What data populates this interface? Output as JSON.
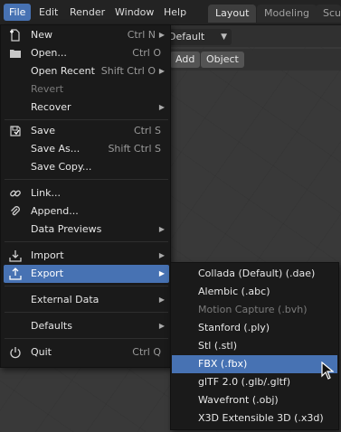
{
  "topbar": {
    "menus": [
      "File",
      "Edit",
      "Render",
      "Window",
      "Help"
    ],
    "workspaces": [
      "Layout",
      "Modeling",
      "Scu"
    ]
  },
  "viewport": {
    "orientation_value": "Default",
    "buttons": [
      "Add",
      "Object"
    ]
  },
  "file_menu": {
    "items": [
      {
        "label": "New",
        "shortcut": "Ctrl N",
        "icon": "new-file-icon",
        "submenu": true
      },
      {
        "label": "Open...",
        "shortcut": "Ctrl O",
        "icon": "folder-icon",
        "submenu": false
      },
      {
        "label": "Open Recent",
        "shortcut": "Shift Ctrl O",
        "icon": "",
        "submenu": true
      },
      {
        "label": "Revert",
        "shortcut": "",
        "icon": "",
        "submenu": false,
        "disabled": true
      },
      {
        "label": "Recover",
        "shortcut": "",
        "icon": "",
        "submenu": true
      },
      {
        "label": "Save",
        "shortcut": "Ctrl S",
        "icon": "save-icon",
        "submenu": false
      },
      {
        "label": "Save As...",
        "shortcut": "Shift Ctrl S",
        "icon": "",
        "submenu": false
      },
      {
        "label": "Save Copy...",
        "shortcut": "",
        "icon": "",
        "submenu": false
      },
      {
        "label": "Link...",
        "shortcut": "",
        "icon": "link-icon",
        "submenu": false
      },
      {
        "label": "Append...",
        "shortcut": "",
        "icon": "paperclip-icon",
        "submenu": false
      },
      {
        "label": "Data Previews",
        "shortcut": "",
        "icon": "",
        "submenu": true
      },
      {
        "label": "Import",
        "shortcut": "",
        "icon": "import-icon",
        "submenu": true
      },
      {
        "label": "Export",
        "shortcut": "",
        "icon": "export-icon",
        "submenu": true,
        "highlighted": true
      },
      {
        "label": "External Data",
        "shortcut": "",
        "icon": "",
        "submenu": true
      },
      {
        "label": "Defaults",
        "shortcut": "",
        "icon": "",
        "submenu": true
      },
      {
        "label": "Quit",
        "shortcut": "Ctrl Q",
        "icon": "power-icon",
        "submenu": false
      }
    ]
  },
  "export_menu": {
    "items": [
      {
        "label": "Collada (Default) (.dae)"
      },
      {
        "label": "Alembic (.abc)"
      },
      {
        "label": "Motion Capture (.bvh)",
        "disabled": true
      },
      {
        "label": "Stanford (.ply)"
      },
      {
        "label": "Stl (.stl)"
      },
      {
        "label": "FBX (.fbx)",
        "highlighted": true
      },
      {
        "label": "glTF 2.0 (.glb/.gltf)"
      },
      {
        "label": "Wavefront (.obj)"
      },
      {
        "label": "X3D Extensible 3D (.x3d)"
      }
    ]
  },
  "colors": {
    "accent": "#4772b3",
    "menu_bg": "#1a1a1a",
    "topbar_bg": "#232323"
  }
}
